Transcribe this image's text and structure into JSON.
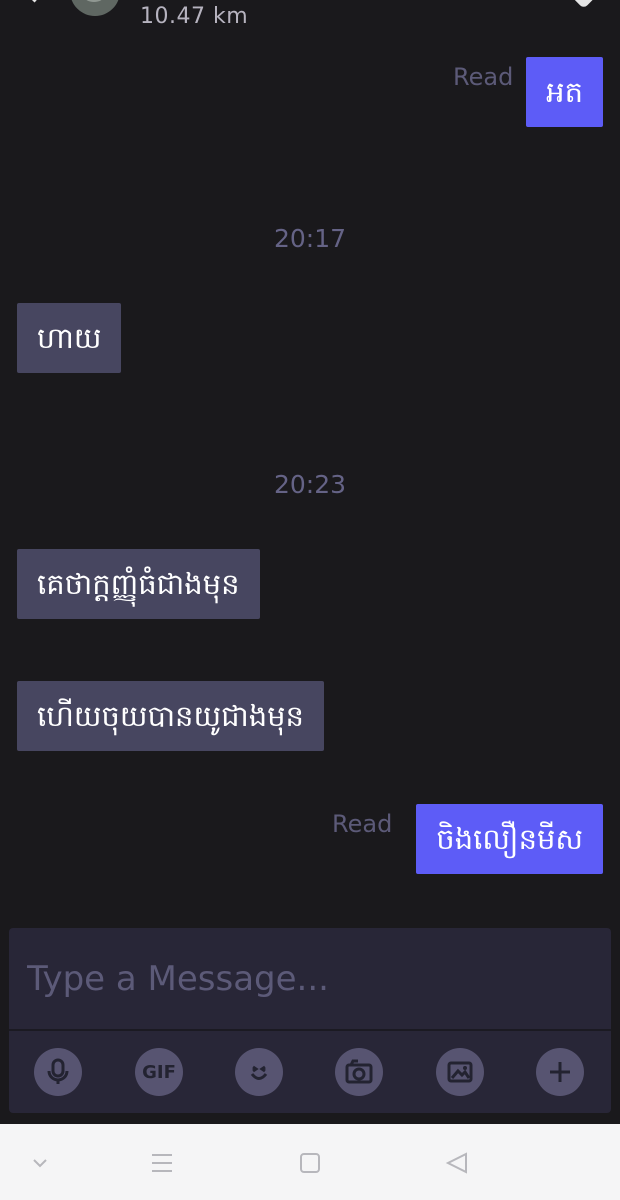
{
  "header": {
    "distance": "10.47 km"
  },
  "messages": [
    {
      "type": "outgoing",
      "status": "Read",
      "text": "អត"
    },
    {
      "type": "time",
      "text": "20:17"
    },
    {
      "type": "incoming",
      "text": "ហាយ"
    },
    {
      "type": "time",
      "text": "20:23"
    },
    {
      "type": "incoming",
      "text": "គេថាក្តញ្ញុំធំជាងមុន"
    },
    {
      "type": "incoming",
      "text": "ហើយចុយបានយូជាងមុន"
    },
    {
      "type": "outgoing",
      "status": "Read",
      "text": "ចិងលឿនមីស"
    }
  ],
  "composer": {
    "placeholder": "Type a Message..."
  },
  "tools": {
    "gif_label": "GIF",
    "icons": [
      "microphone-icon",
      "gif-icon",
      "emoji-icon",
      "camera-icon",
      "image-icon",
      "plus-icon"
    ]
  },
  "navbar": {
    "icons": [
      "chevron-down-icon",
      "menu-icon",
      "home-square-icon",
      "back-triangle-icon"
    ]
  },
  "colors": {
    "background": "#1a191c",
    "outgoing_bubble": "#5d5cf7",
    "incoming_bubble": "#474660",
    "secondary_text": "#5c5a78"
  }
}
